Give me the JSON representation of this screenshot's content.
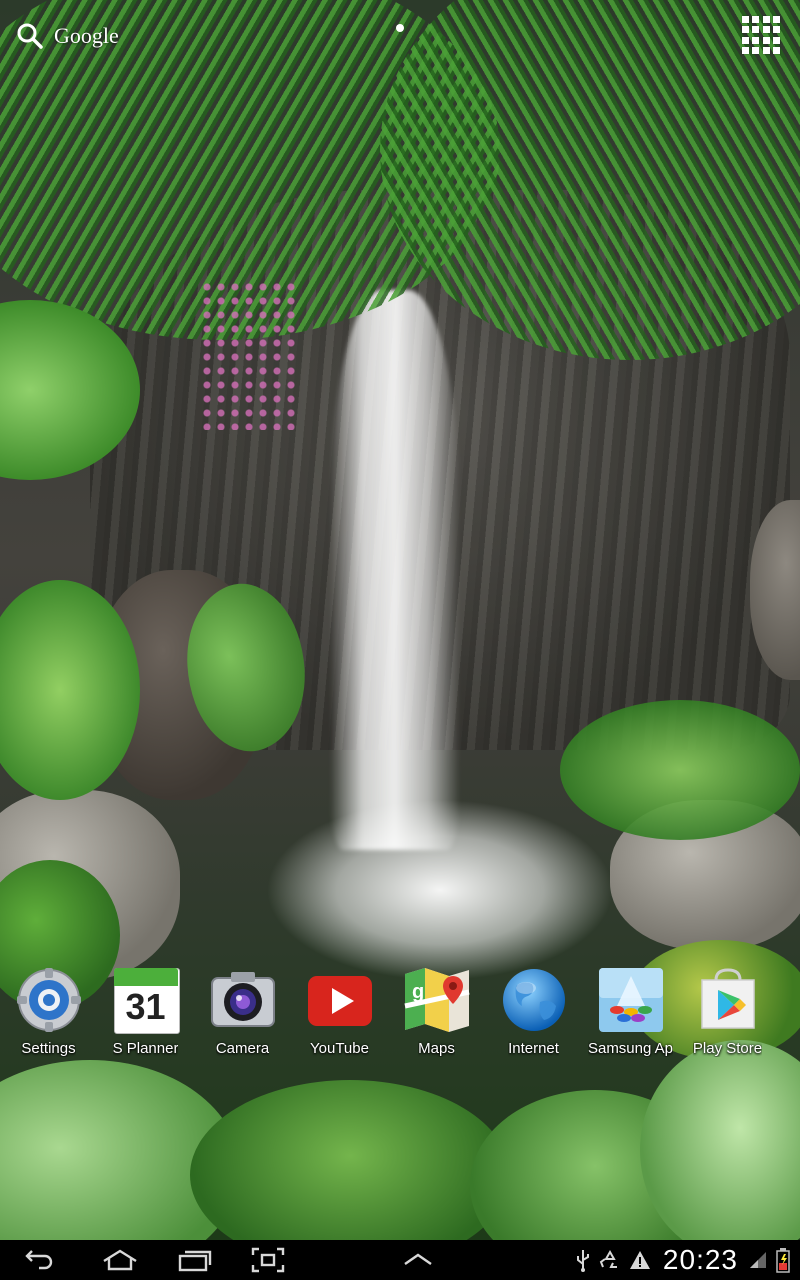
{
  "search": {
    "label": "Google"
  },
  "dock": {
    "apps": [
      {
        "label": "Settings",
        "icon": "settings-icon"
      },
      {
        "label": "S Planner",
        "icon": "calendar-icon",
        "day": "31"
      },
      {
        "label": "Camera",
        "icon": "camera-icon"
      },
      {
        "label": "YouTube",
        "icon": "youtube-icon"
      },
      {
        "label": "Maps",
        "icon": "maps-icon"
      },
      {
        "label": "Internet",
        "icon": "globe-icon"
      },
      {
        "label": "Samsung Ap",
        "icon": "samsung-apps-icon"
      },
      {
        "label": "Play Store",
        "icon": "play-store-icon"
      }
    ]
  },
  "status": {
    "time": "20:23"
  },
  "colors": {
    "navbar": "#000000",
    "youtube_red": "#d8251d",
    "accent_blue": "#2e74c9"
  }
}
